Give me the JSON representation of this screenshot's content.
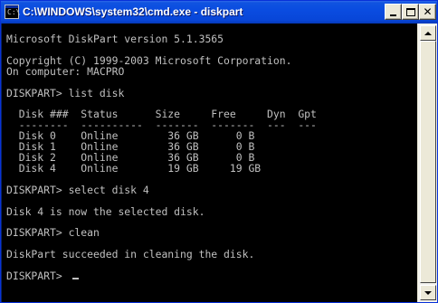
{
  "window": {
    "title": "C:\\WINDOWS\\system32\\cmd.exe - diskpart",
    "icon": "console-icon",
    "controls": {
      "minimize": "minimize-icon",
      "maximize": "maximize-icon",
      "close": "close-icon",
      "close_glyph": "✕"
    }
  },
  "console": {
    "lines": [
      "Microsoft DiskPart version 5.1.3565",
      "",
      "Copyright (C) 1999-2003 Microsoft Corporation.",
      "On computer: MACPRO",
      "",
      "DISKPART> list disk",
      "",
      "  Disk ###  Status      Size     Free     Dyn  Gpt",
      "  --------  ----------  -------  -------  ---  ---",
      "  Disk 0    Online        36 GB      0 B",
      "  Disk 1    Online        36 GB      0 B",
      "  Disk 2    Online        36 GB      0 B",
      "  Disk 4    Online        19 GB     19 GB",
      "",
      "DISKPART> select disk 4",
      "",
      "Disk 4 is now the selected disk.",
      "",
      "DISKPART> clean",
      "",
      "DiskPart succeeded in cleaning the disk.",
      "",
      "DISKPART> "
    ]
  },
  "colors": {
    "console_bg": "#000000",
    "console_text": "#C0C0C0",
    "titlebar": "#0A4CE0"
  }
}
